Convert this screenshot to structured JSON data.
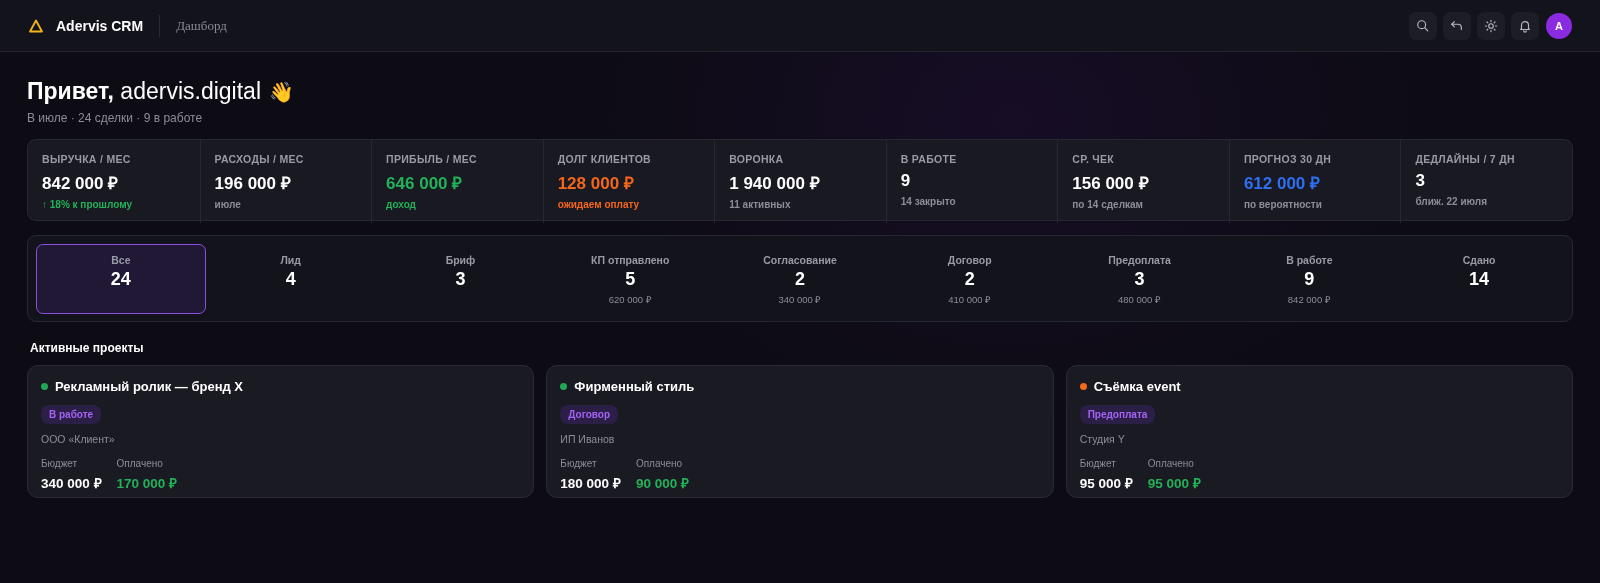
{
  "header": {
    "brand": "Adervis CRM",
    "breadcrumb": "Дашборд",
    "avatar": "A"
  },
  "greeting": {
    "title": "**Привет,** adervis.digital",
    "emoji": "👋",
    "subtitle": "В июле · 24 сделки · 9 в работе"
  },
  "kpis": [
    {
      "label": "ВЫРУЧКА / МЕС",
      "value": {
        "text": "842 000 ₽",
        "color": "#ffffff"
      },
      "note": {
        "text": "↑ 18% к прошлому",
        "color": "#22b159"
      }
    },
    {
      "label": "РАСХОДЫ / МЕС",
      "value": {
        "text": "196 000 ₽",
        "color": "#ffffff"
      },
      "note": {
        "text": "июле",
        "color": "#8d8d99"
      }
    },
    {
      "label": "ПРИБЫЛЬ / МЕС",
      "value": {
        "text": "646 000 ₽",
        "color": "#22b159"
      },
      "note": {
        "text": "доход",
        "color": "#22b159"
      }
    },
    {
      "label": "ДОЛГ КЛИЕНТОВ",
      "value": {
        "text": "128 000 ₽",
        "color": "#f4661b"
      },
      "note": {
        "text": "ожидаем оплату",
        "color": "#f4661b"
      }
    },
    {
      "label": "ВОРОНКА",
      "value": {
        "text": "1 940 000 ₽",
        "color": "#ffffff"
      },
      "note": {
        "text": "11 активных",
        "color": "#8d8d99"
      }
    },
    {
      "label": "В РАБОТЕ",
      "value": {
        "text": "9",
        "color": "#ffffff"
      },
      "note": {
        "text": "14 закрыто",
        "color": "#8d8d99"
      }
    },
    {
      "label": "СР. ЧЕК",
      "value": {
        "text": "156 000 ₽",
        "color": "#ffffff"
      },
      "note": {
        "text": "по 14 сделкам",
        "color": "#8d8d99"
      }
    },
    {
      "label": "ПРОГНОЗ 30 ДН",
      "value": {
        "text": "612 000 ₽",
        "color": "#2f6ff2"
      },
      "note": {
        "text": "по вероятности",
        "color": "#8d8d99"
      }
    },
    {
      "label": "ДЕДЛАЙНЫ / 7 ДН",
      "value": {
        "text": "3",
        "color": "#ffffff"
      },
      "note": {
        "text": "ближ. 22 июля",
        "color": "#8d8d99"
      }
    }
  ],
  "stages": [
    {
      "label": "Все",
      "count": "24",
      "selected": true
    },
    {
      "label": "Лид",
      "count": "4",
      "selected": false
    },
    {
      "label": "Бриф",
      "count": "3",
      "selected": false
    },
    {
      "label": "КП отправлено",
      "count": "5",
      "sum": "620 000 ₽",
      "selected": false
    },
    {
      "label": "Согласование",
      "count": "2",
      "sum": "340 000 ₽",
      "selected": false
    },
    {
      "label": "Договор",
      "count": "2",
      "sum": "410 000 ₽",
      "selected": false
    },
    {
      "label": "Предоплата",
      "count": "3",
      "sum": "480 000 ₽",
      "selected": false
    },
    {
      "label": "В работе",
      "count": "9",
      "sum": "842 000 ₽",
      "selected": false
    },
    {
      "label": "Сдано",
      "count": "14",
      "selected": false
    }
  ],
  "projects_title": "Активные проекты",
  "projects": [
    {
      "title": "Рекламный ролик — бренд X",
      "color": "#22a854",
      "status": "В работе",
      "client": "ООО «Клиент»",
      "budget_label": "Бюджет",
      "budget": "340 000 ₽",
      "paid_label": "Оплачено",
      "paid": "170 000 ₽"
    },
    {
      "title": "Фирменный стиль",
      "color": "#22a854",
      "status": "Договор",
      "client": "ИП Иванов",
      "budget_label": "Бюджет",
      "budget": "180 000 ₽",
      "paid_label": "Оплачено",
      "paid": "90 000 ₽"
    },
    {
      "title": "Съёмка event",
      "color": "#f26a1b",
      "status": "Предоплата",
      "client": "Студия Y",
      "budget_label": "Бюджет",
      "budget": "95 000 ₽",
      "paid_label": "Оплачено",
      "paid": "95 000 ₽"
    }
  ]
}
